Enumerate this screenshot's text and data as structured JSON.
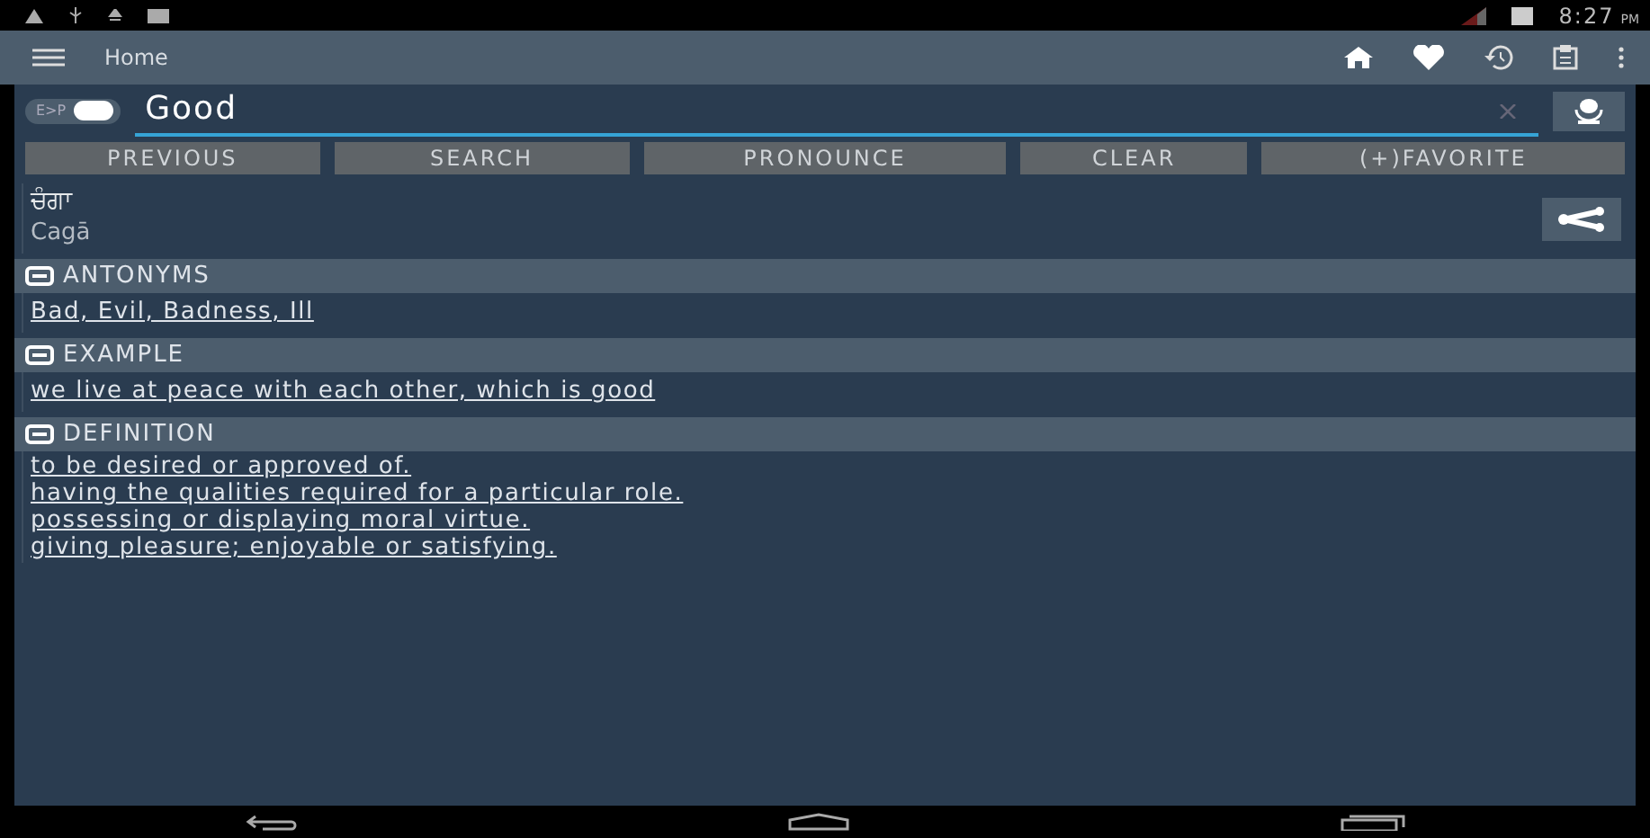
{
  "status_bar": {
    "time": "8:27",
    "ampm": "PM"
  },
  "app_bar": {
    "title": "Home"
  },
  "search": {
    "direction": "E>P",
    "on": true,
    "value": "Good"
  },
  "buttons": [
    "PREVIOUS",
    "SEARCH",
    "PRONOUNCE",
    "CLEAR",
    "(+)FAVORITE"
  ],
  "result": {
    "word": "ਚੰਗਾ",
    "transliteration": "Cagā"
  },
  "sections": [
    {
      "title": "ANTONYMS",
      "expanded": true,
      "lines": [
        "Bad, Evil, Badness, Ill"
      ]
    },
    {
      "title": "EXAMPLE",
      "expanded": true,
      "lines": [
        "we live at peace with each other, which is good"
      ]
    },
    {
      "title": "DEFINITION",
      "expanded": true,
      "lines": [
        "to be desired or approved of.",
        "having the qualities required for a particular role.",
        "possessing or displaying moral virtue.",
        "giving pleasure; enjoyable or satisfying."
      ]
    }
  ]
}
